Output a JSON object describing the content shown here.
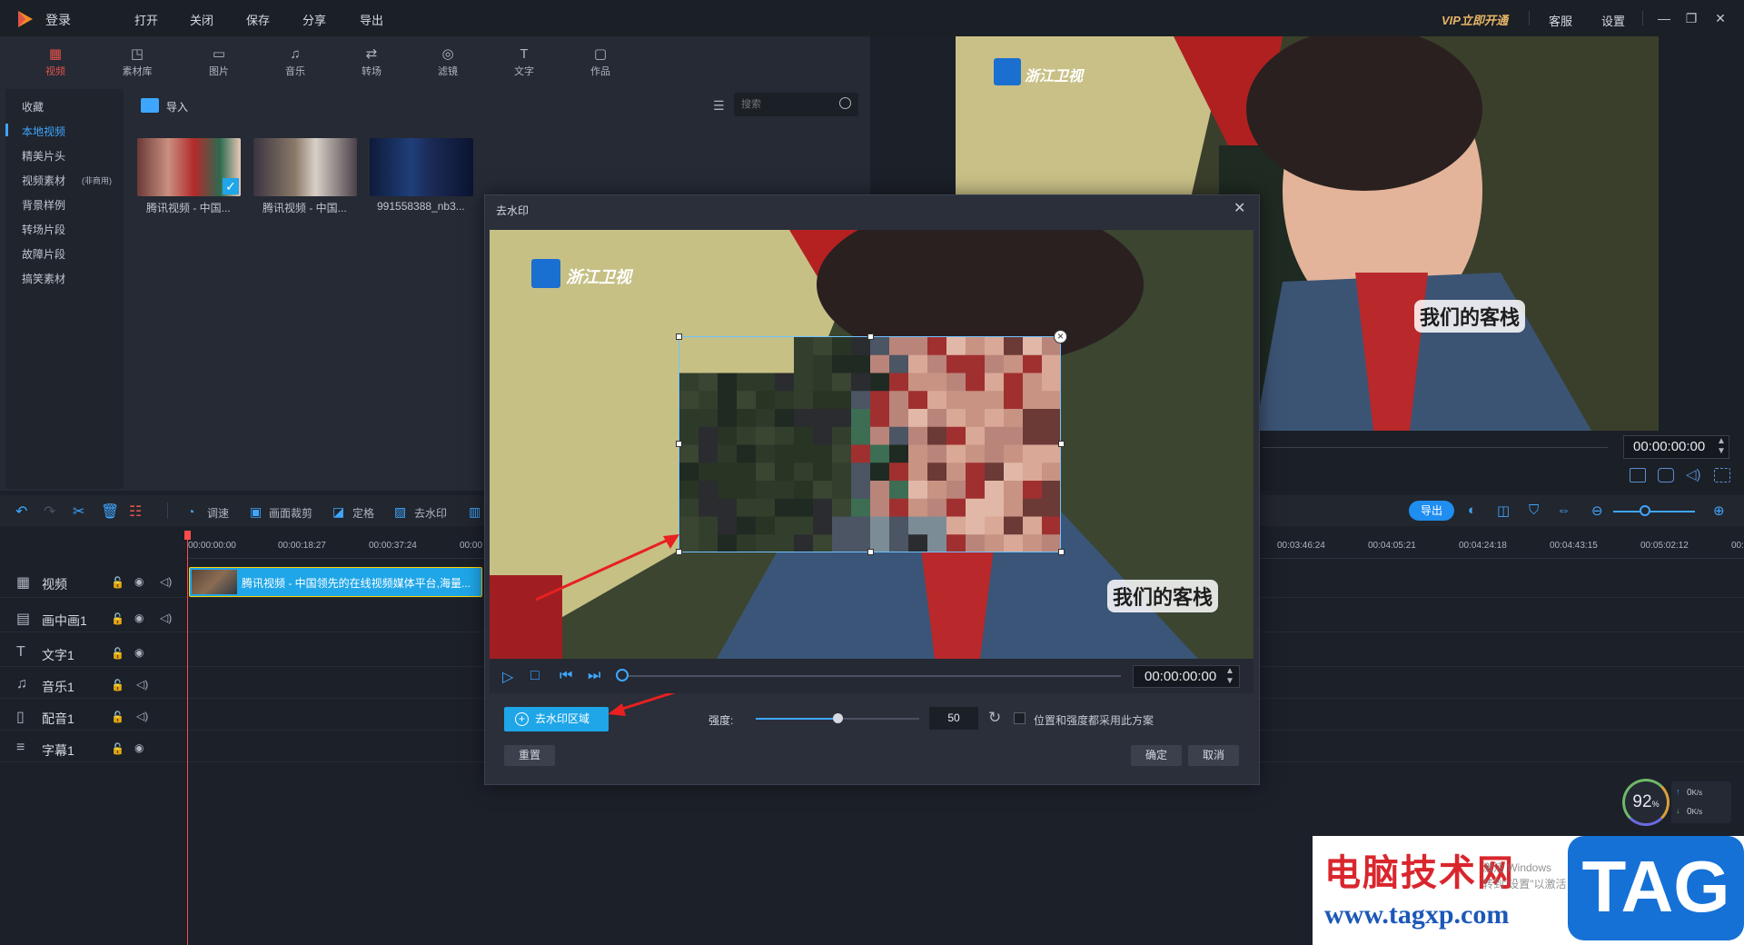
{
  "titlebar": {
    "login": "登录",
    "menu": [
      "打开",
      "关闭",
      "保存",
      "分享",
      "导出"
    ],
    "vip": "VIP立即开通",
    "service": "客服",
    "settings": "设置"
  },
  "tooltabs": [
    {
      "label": "视频",
      "icon": "film-icon"
    },
    {
      "label": "素材库",
      "icon": "library-icon"
    },
    {
      "label": "图片",
      "icon": "image-icon"
    },
    {
      "label": "音乐",
      "icon": "music-icon"
    },
    {
      "label": "转场",
      "icon": "transition-icon"
    },
    {
      "label": "滤镜",
      "icon": "filter-icon"
    },
    {
      "label": "文字",
      "icon": "text-icon"
    },
    {
      "label": "作品",
      "icon": "folder-icon"
    }
  ],
  "categories": [
    "收藏",
    "本地视频",
    "精美片头",
    "视频素材",
    "背景样例",
    "转场片段",
    "故障片段",
    "搞笑素材"
  ],
  "category_badge": "(非商用)",
  "media": {
    "import_label": "导入",
    "search_placeholder": "搜索",
    "items": [
      {
        "caption": "腾讯视频 - 中国..."
      },
      {
        "caption": "腾讯视频 - 中国..."
      },
      {
        "caption": "991558388_nb3..."
      }
    ]
  },
  "preview": {
    "time": "00:00:00:00",
    "channel_logo": "浙江卫视",
    "show_logo": "我们的客栈"
  },
  "toolbar": {
    "adjust": "调速",
    "crop": "画面裁剪",
    "freeze": "定格",
    "remove_watermark": "去水印",
    "export": "导出"
  },
  "ruler": {
    "left_ticks": [
      "00:00:00:00",
      "00:00:18:27",
      "00:00:37:24",
      "00:00"
    ],
    "right_ticks": [
      "00:03:46:24",
      "00:04:05:21",
      "00:04:24:18",
      "00:04:43:15",
      "00:05:02:12",
      "00:0"
    ]
  },
  "tracks": [
    {
      "name": "视频",
      "icon": "film-icon"
    },
    {
      "name": "画中画1",
      "icon": "pip-icon"
    },
    {
      "name": "文字1",
      "icon": "text-icon"
    },
    {
      "name": "音乐1",
      "icon": "music-icon"
    },
    {
      "name": "配音1",
      "icon": "mic-icon"
    },
    {
      "name": "字幕1",
      "icon": "subtitle-icon"
    }
  ],
  "clip": {
    "label": "腾讯视频 - 中国领先的在线视频媒体平台,海量..."
  },
  "dialog": {
    "title": "去水印",
    "time": "00:00:00:00",
    "add_area": "去水印区域",
    "strength_label": "强度:",
    "strength_value": "50",
    "strength_fraction": 0.5,
    "apply_all_label": "位置和强度都采用此方案",
    "reset": "重置",
    "ok": "确定",
    "cancel": "取消"
  },
  "status": {
    "cpu": "92",
    "cpu_unit": "%",
    "up": "0",
    "down": "0",
    "unit": "K/s"
  },
  "watermark_site": {
    "cn": "电脑技术网",
    "url": "www.tagxp.com",
    "tag": "TAG"
  },
  "activation": {
    "line1": "激活 Windows",
    "line2": "转到\"设置\"以激活 Windows。"
  },
  "colors": {
    "accent": "#1fa6e8",
    "active_tab": "#e0524b",
    "playhead": "#ff4b4b"
  }
}
